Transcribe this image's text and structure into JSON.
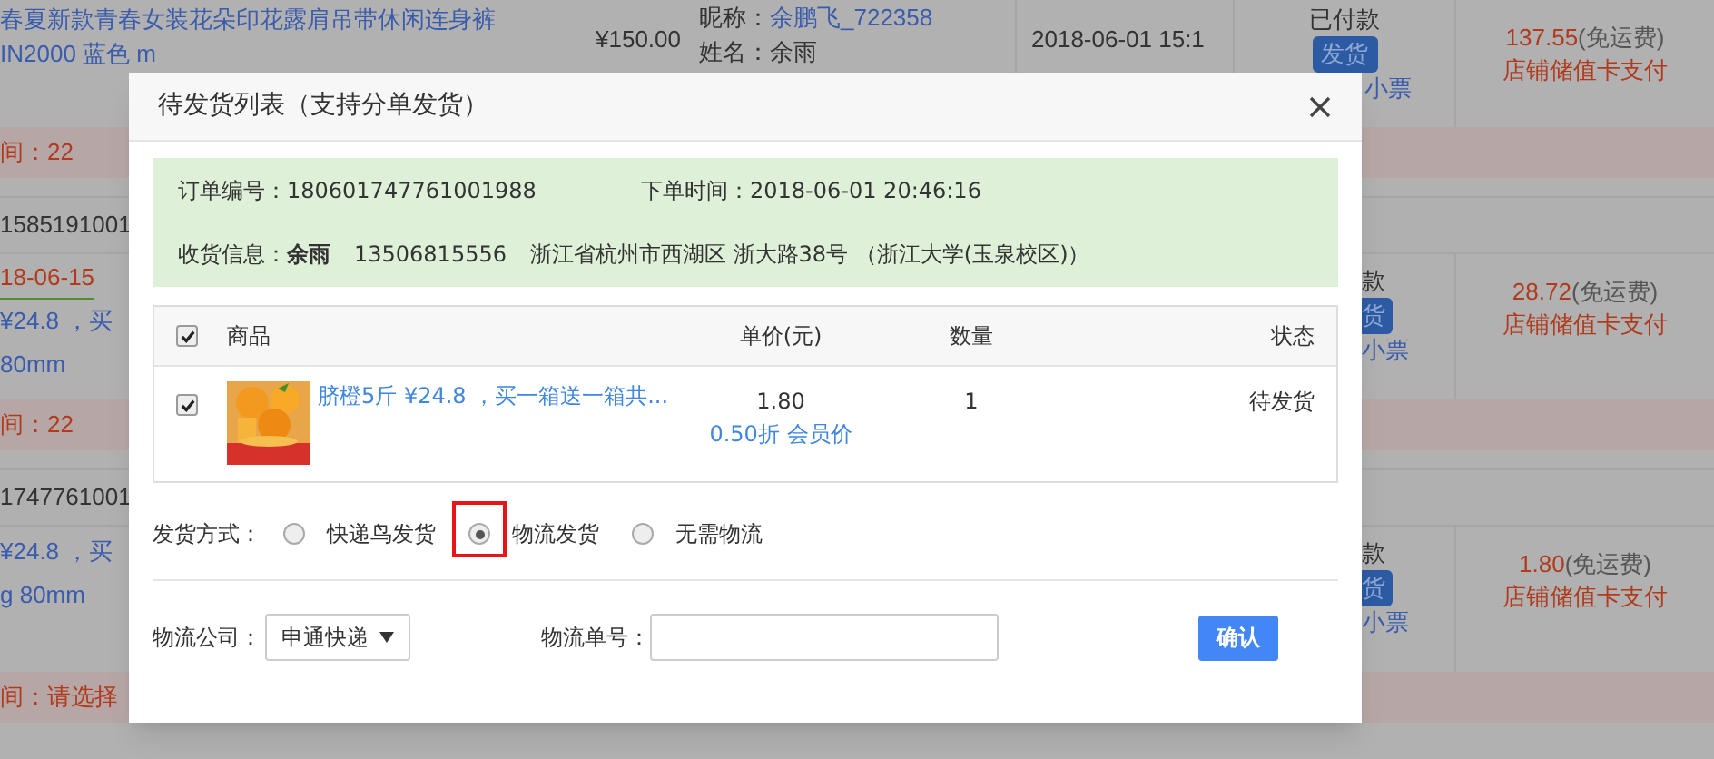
{
  "orders": [
    {
      "product": [
        "春夏新款青春女装花朵印花露肩吊带休闲连身裤",
        "IN2000 蓝色 m"
      ],
      "price": "¥150.00",
      "nickname_label": "昵称：",
      "nickname": "余鹏飞_722358",
      "name_label": "姓名：",
      "name": "余雨",
      "date": "2018-06-01 15:1",
      "status": "已付款",
      "ship_button": "发货",
      "receipt_link": "小票",
      "amount": "137.55",
      "shipping_note": "(免运费)",
      "payment": "店铺储值卡支付",
      "footer": "间：22"
    },
    {
      "order_number": "1585191001",
      "delivery_note": "18-06-15",
      "product": [
        "¥24.8 ，买",
        "80mm"
      ],
      "status": "款",
      "ship_button": "货",
      "receipt_link": "小票",
      "amount": "28.72",
      "shipping_note": "(免运费)",
      "payment": "店铺储值卡支付",
      "footer": "间：22"
    },
    {
      "order_number": "1747761001",
      "product": [
        "¥24.8 ，买",
        "g 80mm"
      ],
      "status": "款",
      "ship_button": "货",
      "receipt_link": "小票",
      "amount": "1.80",
      "shipping_note": "(免运费)",
      "payment": "店铺储值卡支付",
      "footer": "间：请选择"
    }
  ],
  "dialog": {
    "title": "待发货列表（支持分单发货）",
    "order_info": {
      "number_label": "订单编号：",
      "number": "180601747761001988",
      "time_label": "下单时间：",
      "time": "2018-06-01 20:46:16",
      "receiver_label": "收货信息：",
      "receiver_name": "余雨",
      "phone": "13506815556",
      "address": "浙江省杭州市西湖区 浙大路38号 （浙江大学(玉泉校区)）"
    },
    "table": {
      "all_checked": true,
      "columns": [
        "商品",
        "单价(元)",
        "数量",
        "状态"
      ],
      "rows": [
        {
          "checked": true,
          "product": "脐橙5斤 ¥24.8 ，买一箱送一箱共...",
          "price": "1.80",
          "discount": "0.50折 会员价",
          "quantity": "1",
          "status": "待发货"
        }
      ]
    },
    "shipping": {
      "label": "发货方式：",
      "options": [
        {
          "label": "快递鸟发货",
          "selected": false,
          "highlighted": false
        },
        {
          "label": "物流发货",
          "selected": true,
          "highlighted": true
        },
        {
          "label": "无需物流",
          "selected": false,
          "highlighted": false
        }
      ]
    },
    "company_label": "物流公司：",
    "company": "申通快递",
    "tracking_label": "物流单号：",
    "confirm": "确认"
  }
}
